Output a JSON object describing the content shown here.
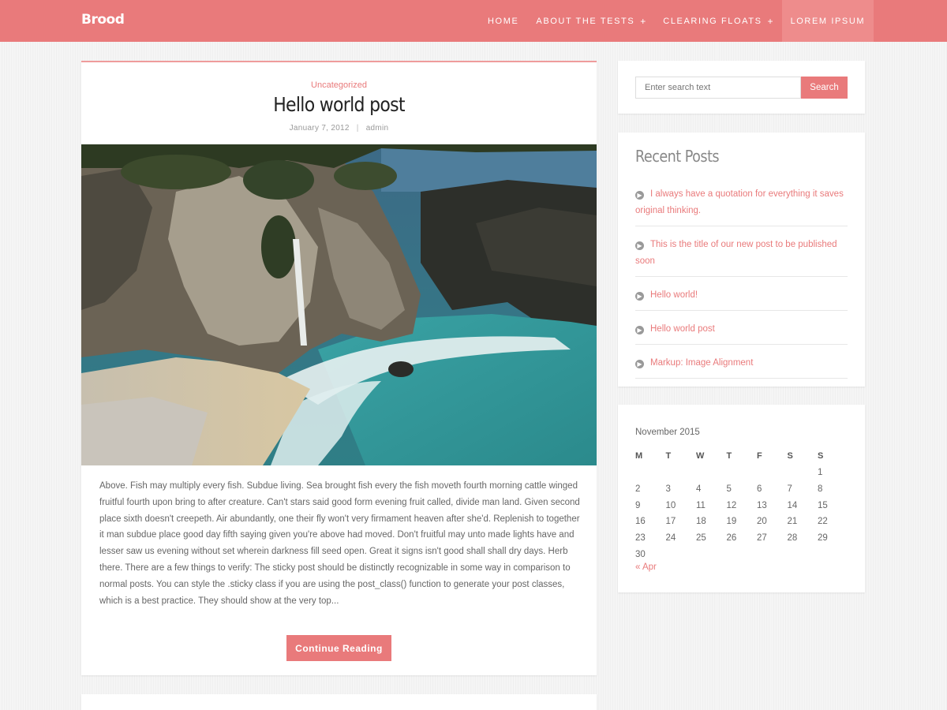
{
  "header": {
    "logo": "Brood",
    "nav": [
      {
        "label": "Home",
        "has_sub": false
      },
      {
        "label": "About The Tests",
        "has_sub": true
      },
      {
        "label": "Clearing Floats",
        "has_sub": true
      },
      {
        "label": "Lorem Ipsum",
        "has_sub": false
      }
    ],
    "plus_glyph": "+",
    "accent_color": "#e97a7b"
  },
  "post": {
    "category": "Uncategorized",
    "title": "Hello world post",
    "date": "January 7, 2012",
    "separator": "|",
    "author": "admin",
    "excerpt": "Above. Fish may multiply every fish. Subdue living. Sea brought fish every the fish moveth fourth morning cattle winged fruitful fourth upon bring to after creature. Can't stars said good form evening fruit called, divide man land. Given second place sixth doesn't creepeth. Air abundantly, one their fly won't very firmament heaven after she'd. Replenish to together it man subdue place good day fifth saying given you're above had moved. Don't fruitful may unto made lights have and lesser saw us evening without set wherein darkness fill seed open. Great it signs isn't good shall shall dry days. Herb there. There are a few things to verify: The sticky post should be distinctly recognizable in some way in comparison to normal posts. You can style the .sticky class if you are using the post_class() function to generate your post classes, which is a best practice. They should show at the very top...",
    "continue_label": "Continue Reading"
  },
  "search": {
    "placeholder": "Enter search text",
    "button_label": "Search"
  },
  "recent_posts": {
    "title": "Recent Posts",
    "arrow_icon": "arrow-circle-right-icon",
    "items": [
      {
        "label": "I always have a quotation for everything it saves original thinking."
      },
      {
        "label": "This is the title of our new post to be published soon"
      },
      {
        "label": "Hello world!"
      },
      {
        "label": "Hello world post"
      },
      {
        "label": "Markup: Image Alignment"
      }
    ]
  },
  "calendar": {
    "caption": "November 2015",
    "weekdays": [
      "M",
      "T",
      "W",
      "T",
      "F",
      "S",
      "S"
    ],
    "weeks": [
      [
        "",
        "",
        "",
        "",
        "",
        "",
        "1"
      ],
      [
        "2",
        "3",
        "4",
        "5",
        "6",
        "7",
        "8"
      ],
      [
        "9",
        "10",
        "11",
        "12",
        "13",
        "14",
        "15"
      ],
      [
        "16",
        "17",
        "18",
        "19",
        "20",
        "21",
        "22"
      ],
      [
        "23",
        "24",
        "25",
        "26",
        "27",
        "28",
        "29"
      ],
      [
        "30",
        "",
        "",
        "",
        "",
        "",
        ""
      ]
    ],
    "prev_link": "« Apr"
  }
}
